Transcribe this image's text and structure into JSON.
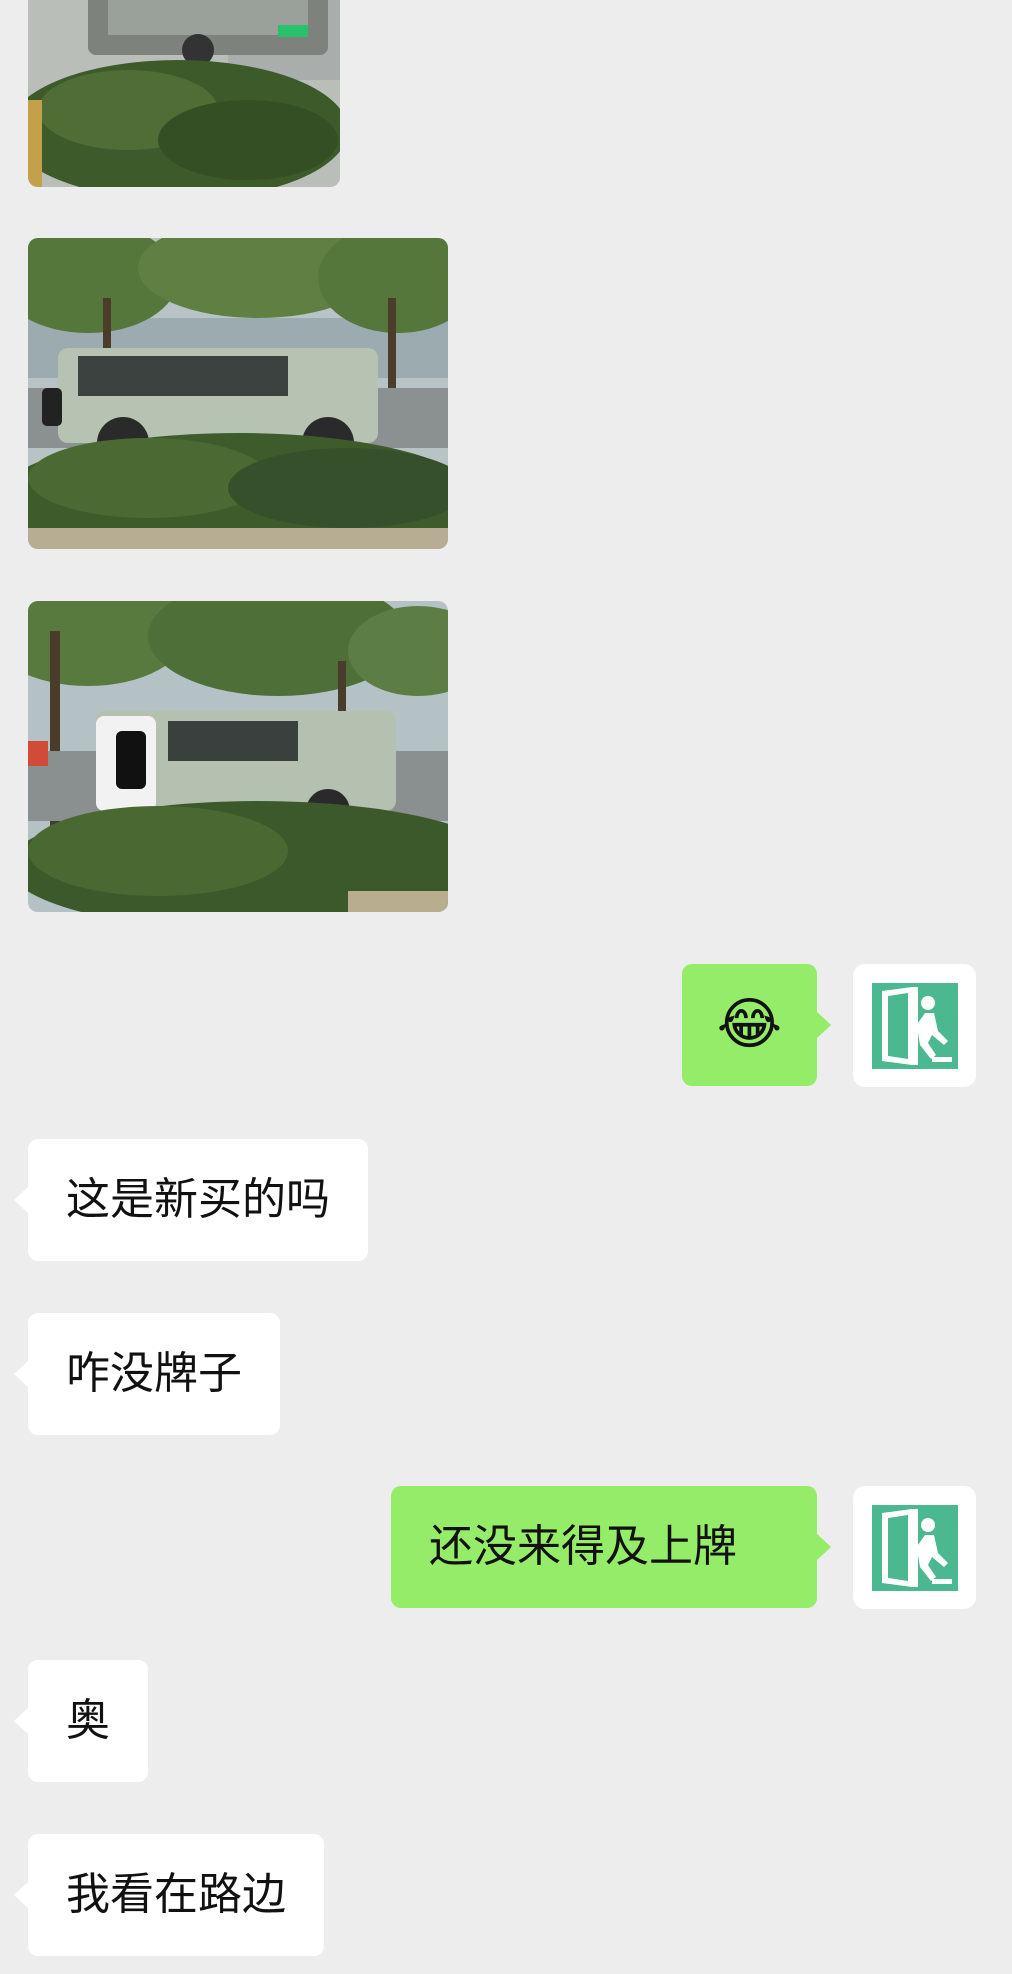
{
  "conversation": {
    "images": [
      {
        "alt": "photo of green SUV parked behind hedge (cropped)"
      },
      {
        "alt": "side view of light green SUV by hedge"
      },
      {
        "alt": "rear three-quarter view of light green SUV by hedge"
      }
    ],
    "messages": [
      {
        "side": "right",
        "text": "😂"
      },
      {
        "side": "left",
        "text": "这是新买的吗"
      },
      {
        "side": "left",
        "text": "咋没牌子"
      },
      {
        "side": "right",
        "text": "还没来得及上牌"
      },
      {
        "side": "left",
        "text": "奥"
      },
      {
        "side": "left",
        "text": "我看在路边"
      }
    ]
  },
  "avatar_icon": "emergency-exit-icon",
  "colors": {
    "background": "#ededed",
    "bubble_left": "#ffffff",
    "bubble_right": "#95ec69",
    "avatar_green": "#4cb88f"
  }
}
